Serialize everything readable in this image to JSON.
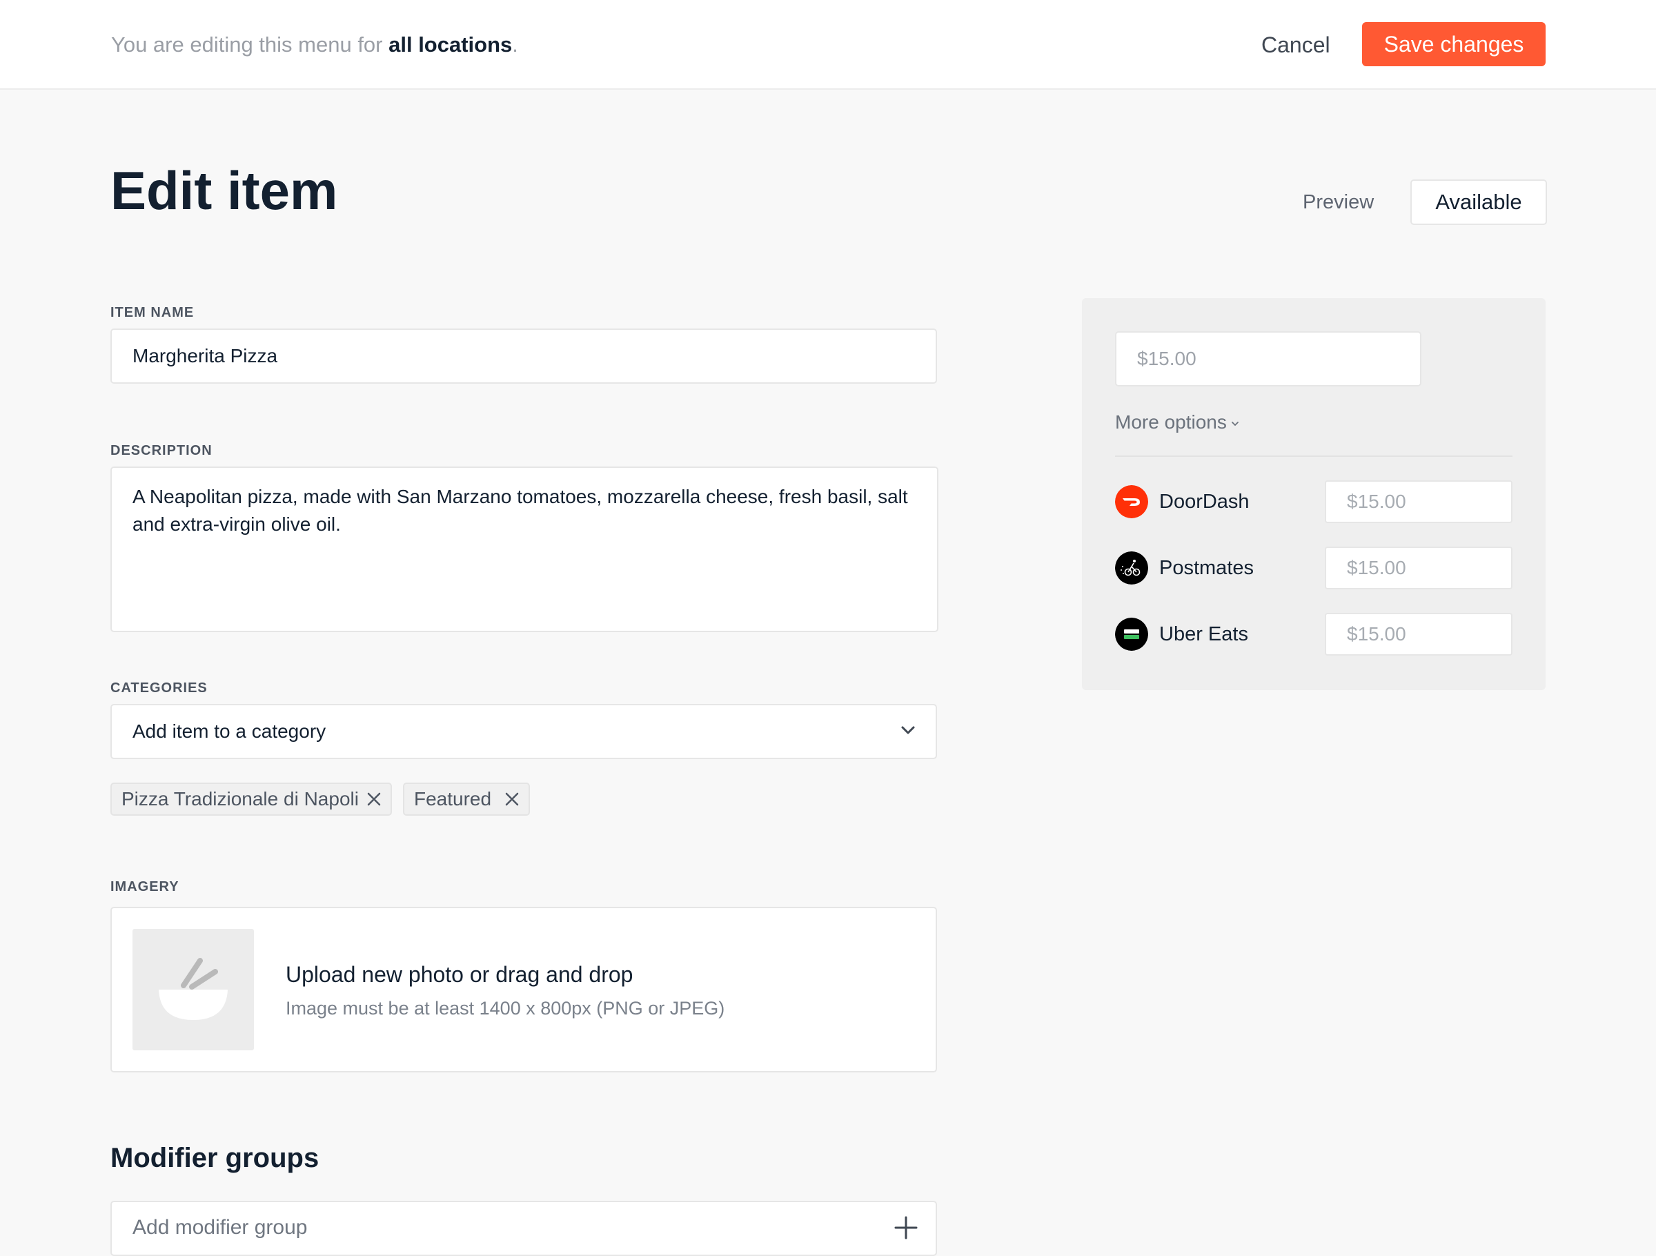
{
  "topbar": {
    "message_prefix": "You are editing this menu for ",
    "message_scope": "all locations",
    "message_suffix": ".",
    "cancel_label": "Cancel",
    "save_label": "Save changes"
  },
  "header": {
    "title": "Edit item",
    "preview_label": "Preview",
    "status_label": "Available"
  },
  "form": {
    "item_name": {
      "label": "ITEM NAME",
      "value": "Margherita Pizza"
    },
    "description": {
      "label": "DESCRIPTION",
      "value": "A Neapolitan pizza, made with San Marzano tomatoes, mozzarella cheese, fresh basil, salt and extra-virgin olive oil."
    },
    "categories": {
      "label": "CATEGORIES",
      "placeholder": "Add item to a category",
      "tags": [
        "Pizza Tradizionale di Napoli",
        "Featured"
      ]
    },
    "imagery": {
      "label": "IMAGERY",
      "upload_title": "Upload new photo or drag and drop",
      "upload_hint": "Image must be at least 1400 x 800px (PNG or JPEG)"
    },
    "modifier_groups": {
      "title": "Modifier groups",
      "add_label": "Add modifier group"
    }
  },
  "pricing": {
    "base_price": "$15.00",
    "more_options_label": "More options",
    "providers": [
      {
        "name": "DoorDash",
        "price": "$15.00",
        "logo_color": "#ff3008"
      },
      {
        "name": "Postmates",
        "price": "$15.00",
        "logo_color": "#000000"
      },
      {
        "name": "Uber Eats",
        "price": "$15.00",
        "logo_color": "#000000"
      }
    ]
  },
  "colors": {
    "accent": "#ff5933",
    "text_primary": "#132030",
    "background": "#f8f8f8",
    "panel": "#efefef"
  }
}
